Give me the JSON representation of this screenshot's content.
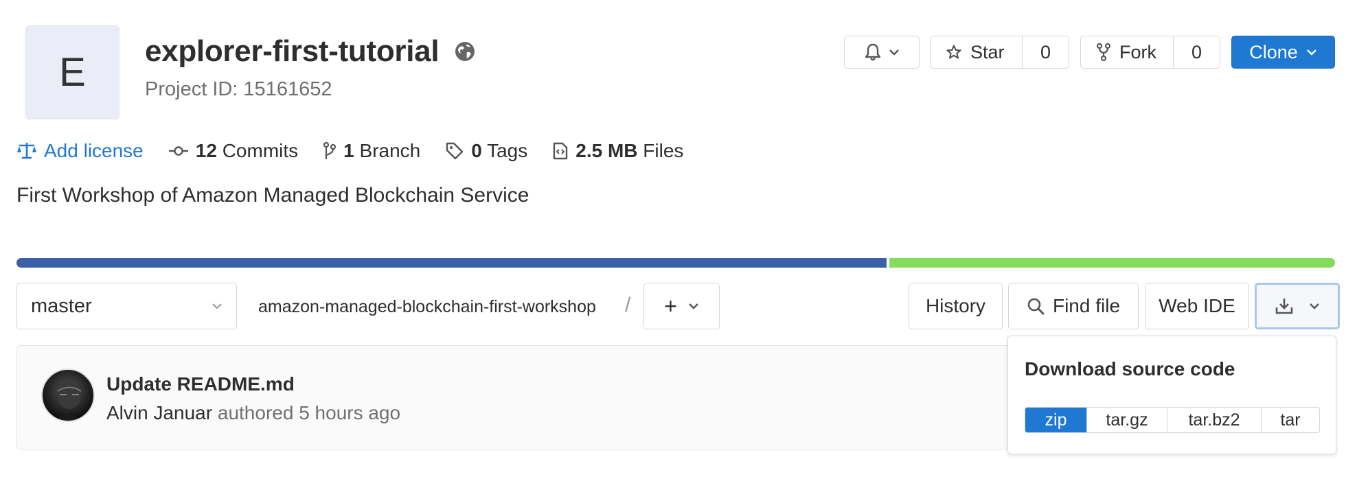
{
  "project": {
    "avatar_letter": "E",
    "title": "explorer-first-tutorial",
    "id_label": "Project ID: 15161652"
  },
  "header_actions": {
    "star_label": "Star",
    "star_count": "0",
    "fork_label": "Fork",
    "fork_count": "0",
    "clone_label": "Clone"
  },
  "stats": {
    "add_license": "Add license",
    "commits_count": "12",
    "commits_label": "Commits",
    "branch_count": "1",
    "branch_label": "Branch",
    "tags_count": "0",
    "tags_label": "Tags",
    "files_size": "2.5 MB",
    "files_label": "Files"
  },
  "description": "First Workshop of Amazon Managed Blockchain Service",
  "language_bar": {
    "colors": [
      "#3d5ea8",
      "#85db5c"
    ]
  },
  "tree": {
    "branch": "master",
    "path": "amazon-managed-blockchain-first-workshop",
    "path_separator": "/",
    "add_symbol": "+",
    "history_label": "History",
    "find_file_label": "Find file",
    "web_ide_label": "Web IDE"
  },
  "commit": {
    "title": "Update README.md",
    "author": "Alvin Januar",
    "meta": "authored 5 hours ago"
  },
  "download": {
    "title": "Download source code",
    "options": [
      "zip",
      "tar.gz",
      "tar.bz2",
      "tar"
    ],
    "selected": "zip"
  },
  "colors": {
    "primary": "#1f78d1",
    "text": "#2e2e2e",
    "muted": "#707070"
  }
}
